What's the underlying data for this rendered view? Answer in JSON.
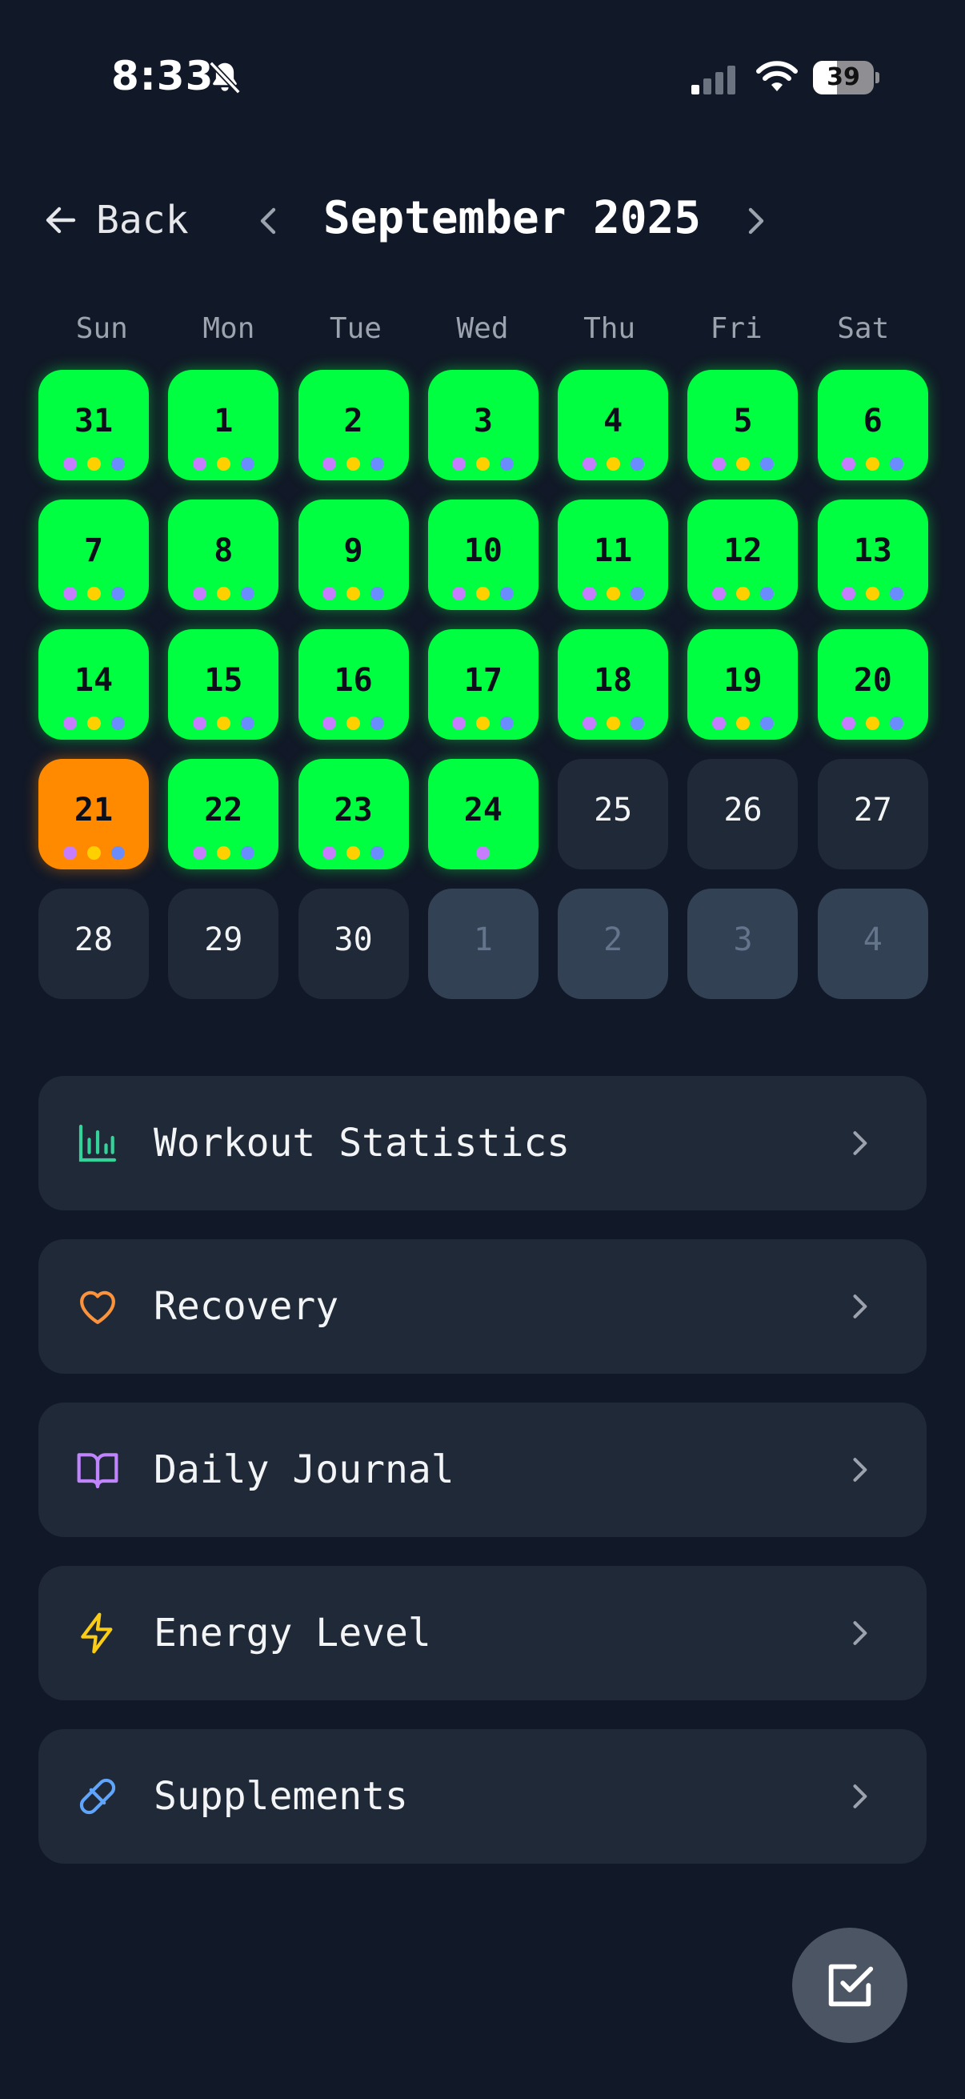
{
  "status_bar": {
    "time": "8:33",
    "battery": "39",
    "battery_level": 0.39
  },
  "header": {
    "back_label": "Back",
    "month_title": "September 2025"
  },
  "calendar": {
    "weekdays": [
      "Sun",
      "Mon",
      "Tue",
      "Wed",
      "Thu",
      "Fri",
      "Sat"
    ],
    "dot_colors": {
      "purple": "#c77dff",
      "yellow": "#ffd000",
      "blue": "#6b8cff"
    },
    "status_colors": {
      "done": "#00ff41",
      "today": "#ff8a00",
      "empty": "#1f2937",
      "other": "#334155"
    },
    "days": [
      {
        "n": "31",
        "s": "done",
        "dots": [
          "purple",
          "yellow",
          "blue"
        ]
      },
      {
        "n": "1",
        "s": "done",
        "dots": [
          "purple",
          "yellow",
          "blue"
        ]
      },
      {
        "n": "2",
        "s": "done",
        "dots": [
          "purple",
          "yellow",
          "blue"
        ]
      },
      {
        "n": "3",
        "s": "done",
        "dots": [
          "purple",
          "yellow",
          "blue"
        ]
      },
      {
        "n": "4",
        "s": "done",
        "dots": [
          "purple",
          "yellow",
          "blue"
        ]
      },
      {
        "n": "5",
        "s": "done",
        "dots": [
          "purple",
          "yellow",
          "blue"
        ]
      },
      {
        "n": "6",
        "s": "done",
        "dots": [
          "purple",
          "yellow",
          "blue"
        ]
      },
      {
        "n": "7",
        "s": "done",
        "dots": [
          "purple",
          "yellow",
          "blue"
        ]
      },
      {
        "n": "8",
        "s": "done",
        "dots": [
          "purple",
          "yellow",
          "blue"
        ]
      },
      {
        "n": "9",
        "s": "done",
        "dots": [
          "purple",
          "yellow",
          "blue"
        ]
      },
      {
        "n": "10",
        "s": "done",
        "dots": [
          "purple",
          "yellow",
          "blue"
        ]
      },
      {
        "n": "11",
        "s": "done",
        "dots": [
          "purple",
          "yellow",
          "blue"
        ]
      },
      {
        "n": "12",
        "s": "done",
        "dots": [
          "purple",
          "yellow",
          "blue"
        ]
      },
      {
        "n": "13",
        "s": "done",
        "dots": [
          "purple",
          "yellow",
          "blue"
        ]
      },
      {
        "n": "14",
        "s": "done",
        "dots": [
          "purple",
          "yellow",
          "blue"
        ]
      },
      {
        "n": "15",
        "s": "done",
        "dots": [
          "purple",
          "yellow",
          "blue"
        ]
      },
      {
        "n": "16",
        "s": "done",
        "dots": [
          "purple",
          "yellow",
          "blue"
        ]
      },
      {
        "n": "17",
        "s": "done",
        "dots": [
          "purple",
          "yellow",
          "blue"
        ]
      },
      {
        "n": "18",
        "s": "done",
        "dots": [
          "purple",
          "yellow",
          "blue"
        ]
      },
      {
        "n": "19",
        "s": "done",
        "dots": [
          "purple",
          "yellow",
          "blue"
        ]
      },
      {
        "n": "20",
        "s": "done",
        "dots": [
          "purple",
          "yellow",
          "blue"
        ]
      },
      {
        "n": "21",
        "s": "today",
        "dots": [
          "purple",
          "yellow",
          "blue"
        ]
      },
      {
        "n": "22",
        "s": "done",
        "dots": [
          "purple",
          "yellow",
          "blue"
        ]
      },
      {
        "n": "23",
        "s": "done",
        "dots": [
          "purple",
          "yellow",
          "blue"
        ]
      },
      {
        "n": "24",
        "s": "done",
        "dots": [
          "purple"
        ]
      },
      {
        "n": "25",
        "s": "empty",
        "dots": []
      },
      {
        "n": "26",
        "s": "empty",
        "dots": []
      },
      {
        "n": "27",
        "s": "empty",
        "dots": []
      },
      {
        "n": "28",
        "s": "empty",
        "dots": []
      },
      {
        "n": "29",
        "s": "empty",
        "dots": []
      },
      {
        "n": "30",
        "s": "empty",
        "dots": []
      },
      {
        "n": "1",
        "s": "other",
        "dots": []
      },
      {
        "n": "2",
        "s": "other",
        "dots": []
      },
      {
        "n": "3",
        "s": "other",
        "dots": []
      },
      {
        "n": "4",
        "s": "other",
        "dots": []
      }
    ]
  },
  "menu": {
    "items": [
      {
        "label": "Workout Statistics",
        "icon": "bar-chart-icon",
        "color": "#34d399"
      },
      {
        "label": "Recovery",
        "icon": "heart-icon",
        "color": "#fb923c"
      },
      {
        "label": "Daily Journal",
        "icon": "book-open-icon",
        "color": "#c084fc"
      },
      {
        "label": "Energy Level",
        "icon": "lightning-icon",
        "color": "#facc15"
      },
      {
        "label": "Supplements",
        "icon": "pill-icon",
        "color": "#60a5fa"
      }
    ]
  },
  "fab": {
    "icon": "checkbox-icon"
  }
}
